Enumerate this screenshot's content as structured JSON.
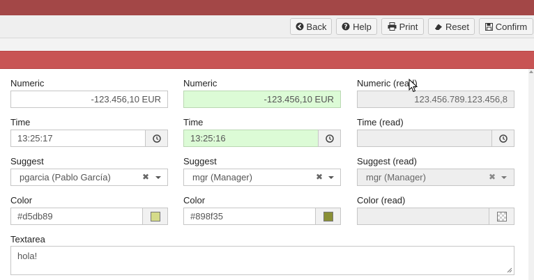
{
  "toolbar": {
    "back_label": "Back",
    "help_label": "Help",
    "print_label": "Print",
    "reset_label": "Reset",
    "confirm_label": "Confirm"
  },
  "form": {
    "numeric": {
      "col1_label": "Numeric",
      "col1_value": "-123.456,10 EUR",
      "col2_label": "Numeric",
      "col2_value": "-123.456,10 EUR",
      "col3_label": "Numeric (read)",
      "col3_value": "123.456.789.123.456,8"
    },
    "time": {
      "col1_label": "Time",
      "col1_value": "13:25:17",
      "col2_label": "Time",
      "col2_value": "13:25:16",
      "col3_label": "Time (read)",
      "col3_value": ""
    },
    "suggest": {
      "col1_label": "Suggest",
      "col1_value": "pgarcia (Pablo García)",
      "col2_label": "Suggest",
      "col2_value": "mgr (Manager)",
      "col3_label": "Suggest (read)",
      "col3_value": "mgr (Manager)",
      "clear_glyph": "✖"
    },
    "color": {
      "col1_label": "Color",
      "col1_value": "#d5db89",
      "col2_label": "Color",
      "col2_value": "#898f35",
      "col3_label": "Color (read)",
      "col3_value": ""
    },
    "textarea": {
      "label": "Textarea",
      "value": "hola!"
    }
  },
  "colors": {
    "topbar": "#a34747",
    "panel_header": "#c85454",
    "modified_field": "#dcfbd6",
    "swatch_1": "#d5db89",
    "swatch_2": "#898f35"
  },
  "icons": [
    "back-icon",
    "help-icon",
    "print-icon",
    "reset-icon",
    "confirm-icon",
    "clock-icon",
    "chevron-down-icon",
    "clear-icon",
    "mouse-cursor-icon",
    "resize-grip-icon"
  ]
}
